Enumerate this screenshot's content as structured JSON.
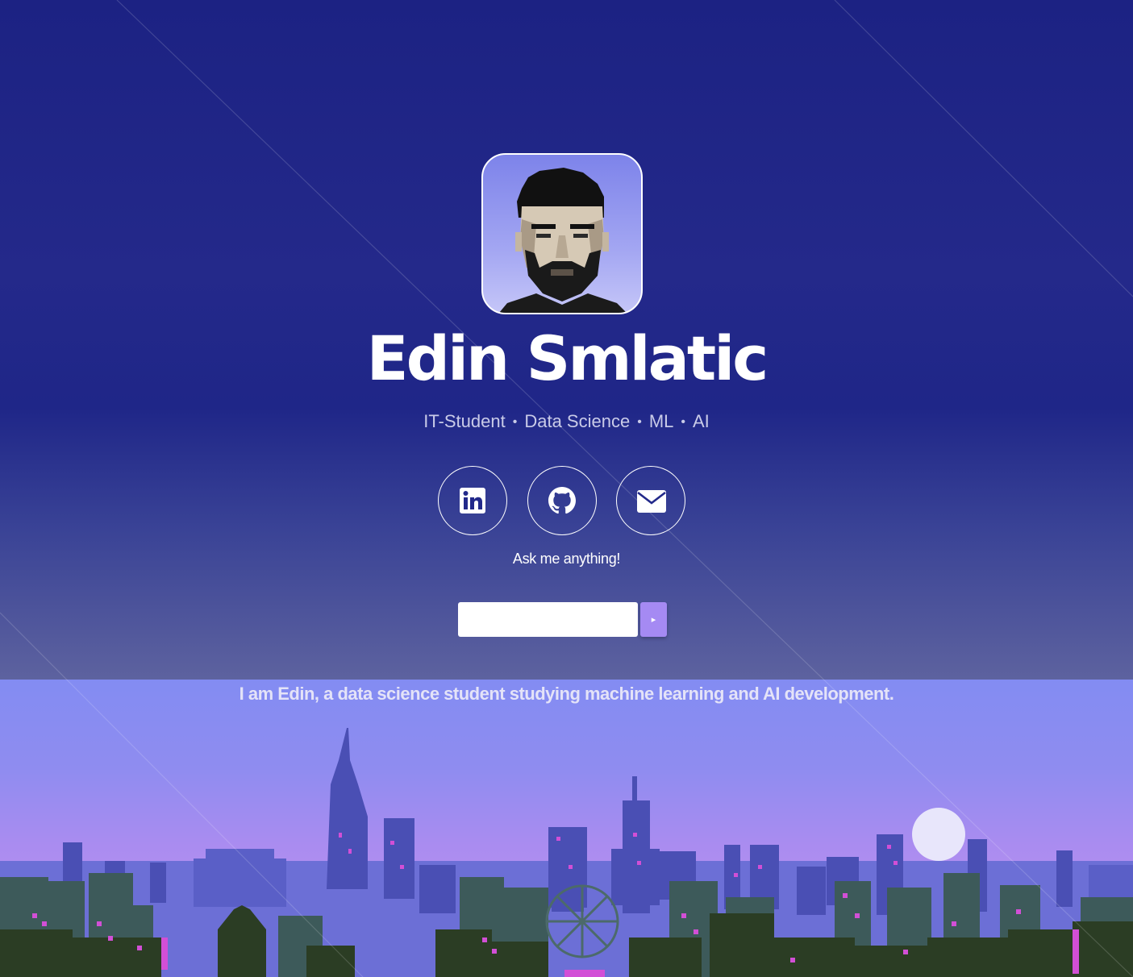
{
  "profile": {
    "name": "Edin Smlatic",
    "tagline_items": [
      "IT-Student",
      "Data Science",
      "ML",
      "AI"
    ],
    "tagline_separator": "•",
    "avatar_icon": "pixel-portrait"
  },
  "socials": [
    {
      "name": "LinkedIn",
      "icon": "linkedin-icon"
    },
    {
      "name": "GitHub",
      "icon": "github-icon"
    },
    {
      "name": "Email",
      "icon": "envelope-icon"
    }
  ],
  "ask": {
    "prompt": "Ask me anything!",
    "input_value": "",
    "submit_label": "▸"
  },
  "bio": "I am Edin, a data science student studying machine learning and AI development.",
  "colors": {
    "background_top": "#1e2382",
    "accent": "#a58af3",
    "text": "#ffffff",
    "city_sky": "#8f8cf0"
  }
}
